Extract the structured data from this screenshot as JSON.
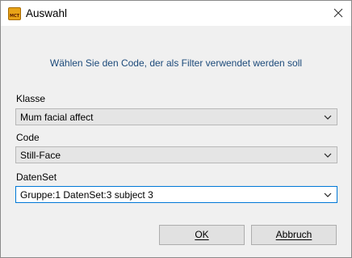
{
  "window": {
    "title": "Auswahl",
    "app_icon_text": "MCT"
  },
  "instruction": "Wählen Sie den Code, der als Filter verwendet werden soll",
  "fields": [
    {
      "label": "Klasse",
      "value": "Mum facial affect"
    },
    {
      "label": "Code",
      "value": "Still-Face"
    },
    {
      "label": "DatenSet",
      "value": "Gruppe:1 DatenSet:3 subject 3"
    }
  ],
  "buttons": {
    "ok": "OK",
    "cancel": "Abbruch"
  },
  "colors": {
    "instruction_text": "#1c4a7a",
    "focus_border": "#0078d7",
    "app_icon": "#e8a317"
  }
}
